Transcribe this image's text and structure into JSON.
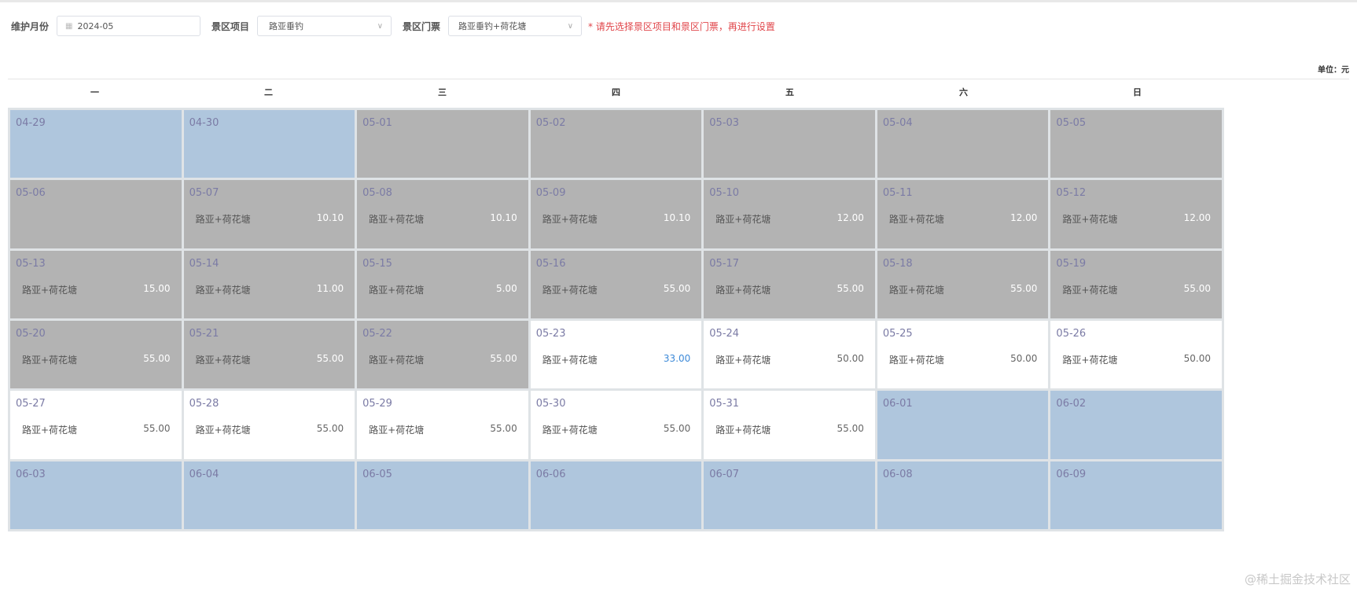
{
  "filters": {
    "month_label": "维护月份",
    "month_value": "2024-05",
    "project_label": "景区项目",
    "project_value": "路亚垂钓",
    "ticket_label": "景区门票",
    "ticket_value": "路亚垂钓+荷花塘",
    "hint": "* 请先选择景区项目和景区门票，再进行设置"
  },
  "unit": "单位：元",
  "weekdays": [
    "一",
    "二",
    "三",
    "四",
    "五",
    "六",
    "日"
  ],
  "days": [
    {
      "date": "04-29",
      "state": "other"
    },
    {
      "date": "04-30",
      "state": "other"
    },
    {
      "date": "05-01",
      "state": "past"
    },
    {
      "date": "05-02",
      "state": "past"
    },
    {
      "date": "05-03",
      "state": "past"
    },
    {
      "date": "05-04",
      "state": "past"
    },
    {
      "date": "05-05",
      "state": "past"
    },
    {
      "date": "05-06",
      "state": "past"
    },
    {
      "date": "05-07",
      "state": "past",
      "ticket": "路亚+荷花塘",
      "price": "10.10"
    },
    {
      "date": "05-08",
      "state": "past",
      "ticket": "路亚+荷花塘",
      "price": "10.10"
    },
    {
      "date": "05-09",
      "state": "past",
      "ticket": "路亚+荷花塘",
      "price": "10.10"
    },
    {
      "date": "05-10",
      "state": "past",
      "ticket": "路亚+荷花塘",
      "price": "12.00"
    },
    {
      "date": "05-11",
      "state": "past",
      "ticket": "路亚+荷花塘",
      "price": "12.00"
    },
    {
      "date": "05-12",
      "state": "past",
      "ticket": "路亚+荷花塘",
      "price": "12.00"
    },
    {
      "date": "05-13",
      "state": "past",
      "ticket": "路亚+荷花塘",
      "price": "15.00"
    },
    {
      "date": "05-14",
      "state": "past",
      "ticket": "路亚+荷花塘",
      "price": "11.00"
    },
    {
      "date": "05-15",
      "state": "past",
      "ticket": "路亚+荷花塘",
      "price": "5.00"
    },
    {
      "date": "05-16",
      "state": "past",
      "ticket": "路亚+荷花塘",
      "price": "55.00"
    },
    {
      "date": "05-17",
      "state": "past",
      "ticket": "路亚+荷花塘",
      "price": "55.00"
    },
    {
      "date": "05-18",
      "state": "past",
      "ticket": "路亚+荷花塘",
      "price": "55.00"
    },
    {
      "date": "05-19",
      "state": "past",
      "ticket": "路亚+荷花塘",
      "price": "55.00"
    },
    {
      "date": "05-20",
      "state": "past",
      "ticket": "路亚+荷花塘",
      "price": "55.00"
    },
    {
      "date": "05-21",
      "state": "past",
      "ticket": "路亚+荷花塘",
      "price": "55.00"
    },
    {
      "date": "05-22",
      "state": "past",
      "ticket": "路亚+荷花塘",
      "price": "55.00"
    },
    {
      "date": "05-23",
      "state": "active",
      "ticket": "路亚+荷花塘",
      "price": "33.00",
      "highlight": true
    },
    {
      "date": "05-24",
      "state": "active",
      "ticket": "路亚+荷花塘",
      "price": "50.00"
    },
    {
      "date": "05-25",
      "state": "active",
      "ticket": "路亚+荷花塘",
      "price": "50.00"
    },
    {
      "date": "05-26",
      "state": "active",
      "ticket": "路亚+荷花塘",
      "price": "50.00"
    },
    {
      "date": "05-27",
      "state": "active",
      "ticket": "路亚+荷花塘",
      "price": "55.00"
    },
    {
      "date": "05-28",
      "state": "active",
      "ticket": "路亚+荷花塘",
      "price": "55.00"
    },
    {
      "date": "05-29",
      "state": "active",
      "ticket": "路亚+荷花塘",
      "price": "55.00"
    },
    {
      "date": "05-30",
      "state": "active",
      "ticket": "路亚+荷花塘",
      "price": "55.00"
    },
    {
      "date": "05-31",
      "state": "active",
      "ticket": "路亚+荷花塘",
      "price": "55.00"
    },
    {
      "date": "06-01",
      "state": "other"
    },
    {
      "date": "06-02",
      "state": "other"
    },
    {
      "date": "06-03",
      "state": "other"
    },
    {
      "date": "06-04",
      "state": "other"
    },
    {
      "date": "06-05",
      "state": "other"
    },
    {
      "date": "06-06",
      "state": "other"
    },
    {
      "date": "06-07",
      "state": "other"
    },
    {
      "date": "06-08",
      "state": "other"
    },
    {
      "date": "06-09",
      "state": "other"
    }
  ],
  "watermark": "@稀土掘金技术社区"
}
